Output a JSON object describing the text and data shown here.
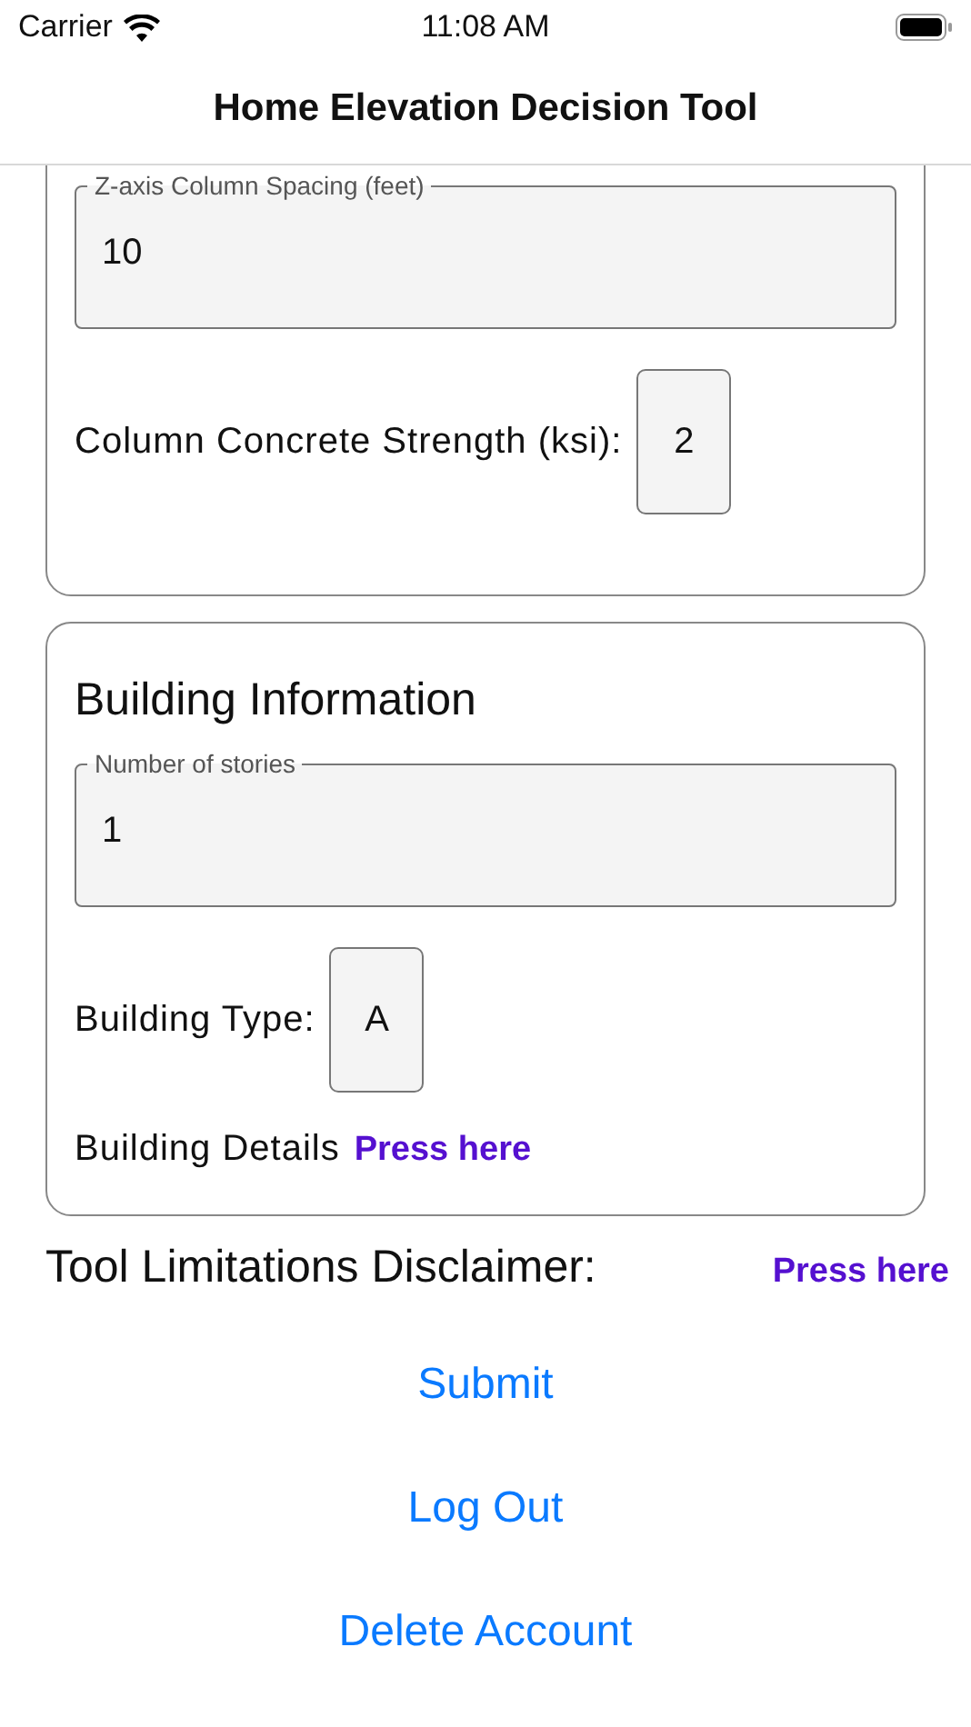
{
  "status_bar": {
    "carrier": "Carrier",
    "time": "11:08 AM"
  },
  "nav_bar": {
    "title": "Home Elevation Decision Tool"
  },
  "sections": [
    {
      "fields": [
        {
          "kind": "outlined",
          "label": "Z-axis Column Spacing (feet)",
          "value": "10"
        },
        {
          "kind": "inline",
          "label": "Column Concrete Strength (ksi):",
          "value": "2"
        }
      ]
    },
    {
      "title": "Building Information",
      "fields": [
        {
          "kind": "outlined",
          "label": "Number of stories",
          "value": "1"
        },
        {
          "kind": "inline",
          "label": "Building Type:",
          "value": "A"
        },
        {
          "kind": "link",
          "label": "Building Details",
          "link": "Press here"
        }
      ]
    }
  ],
  "disclaimer": {
    "label": "Tool Limitations Disclaimer:",
    "link": "Press here"
  },
  "buttons": [
    "Submit",
    "Log Out",
    "Delete Account"
  ]
}
